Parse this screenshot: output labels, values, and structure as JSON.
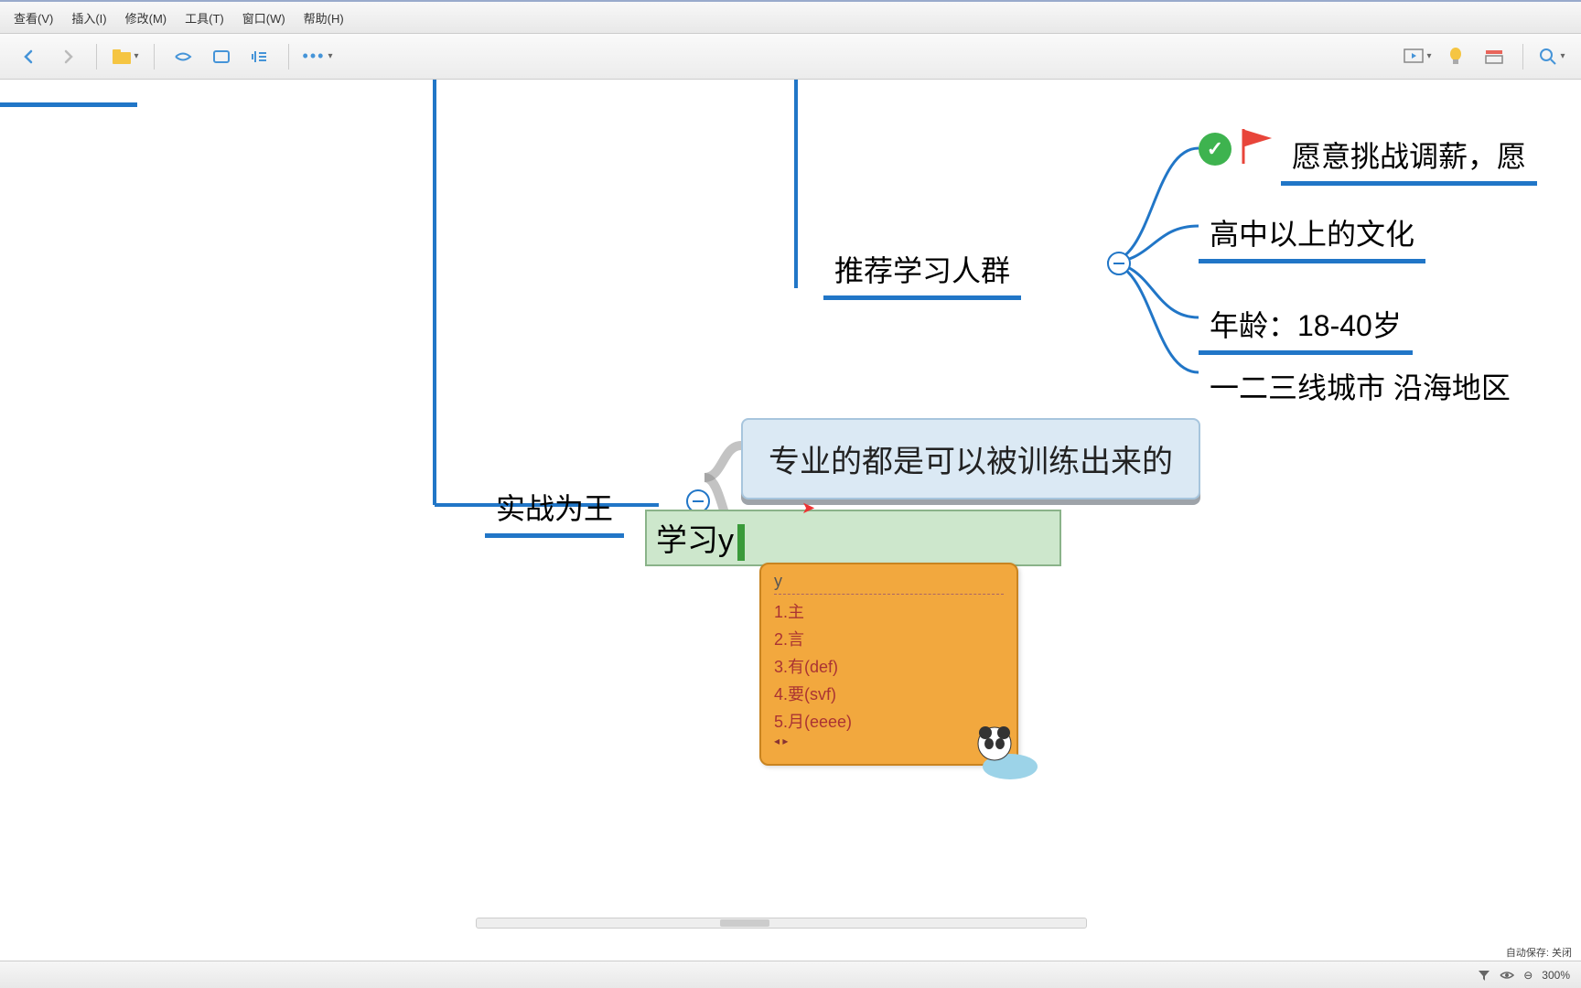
{
  "menu": {
    "view": "查看(V)",
    "insert": "插入(I)",
    "modify": "修改(M)",
    "tools": "工具(T)",
    "window": "窗口(W)",
    "help": "帮助(H)"
  },
  "nodes": {
    "recommend": "推荐学习人群",
    "challenge": "愿意挑战调薪，愿",
    "culture": "高中以上的文化",
    "age": "年龄：18-40岁",
    "city": "一二三线城市  沿海地区",
    "practice": "实战为王",
    "pro": "专业的都是可以被训练出来的",
    "edit": "学习y"
  },
  "ime": {
    "input": "y",
    "items": [
      "1.主",
      "2.言",
      "3.有(def)",
      "4.要(svf)",
      "5.月(eeee)"
    ]
  },
  "status": {
    "autosave": "自动保存: 关闭",
    "zoom": "300%"
  }
}
